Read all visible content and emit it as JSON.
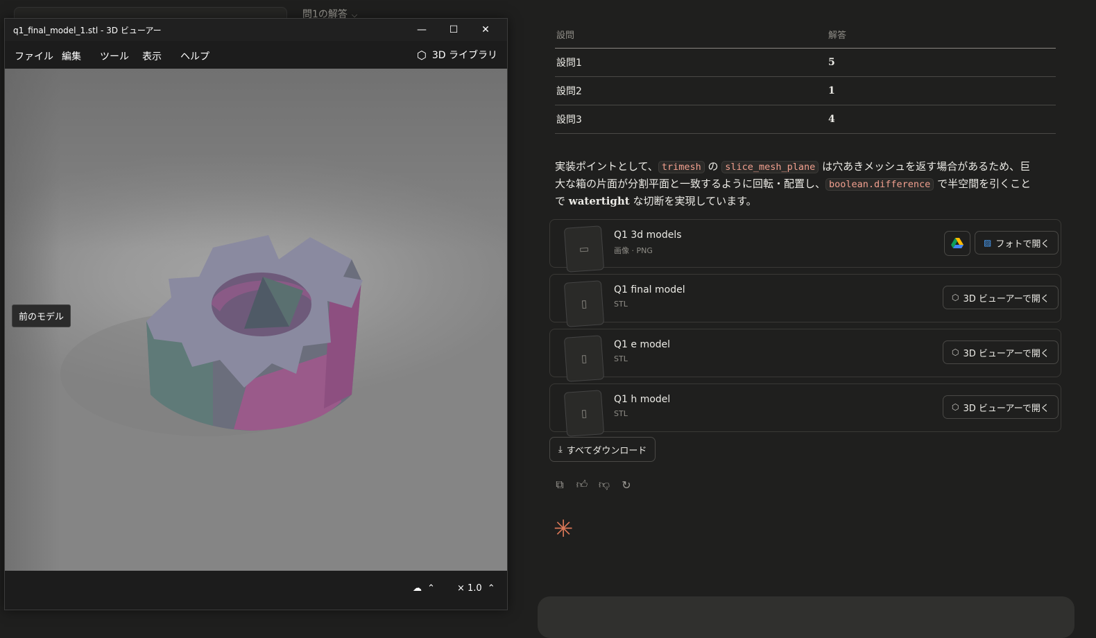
{
  "background": {
    "heading": "問1の解答",
    "table": {
      "headers": [
        "設問",
        "解答"
      ],
      "rows": [
        {
          "q": "設問1",
          "a": "5"
        },
        {
          "q": "設問2",
          "a": "1"
        },
        {
          "q": "設問3",
          "a": "4"
        }
      ]
    },
    "paragraph": {
      "p1": "実装ポイントとして、",
      "code1": "trimesh",
      "p2": " の ",
      "code2": "slice_mesh_plane",
      "p3": " は穴あきメッシュを返す場合があるため、巨大な箱の片面が分割平面と一致するように回転・配置し、",
      "code3": "boolean.difference",
      "p4": " で半空間を引くことで ",
      "serif": "watertight",
      "p5": " な切断を実現しています。"
    },
    "files": [
      {
        "name": "Q1 3d models",
        "sub": "画像 · PNG",
        "button": "フォトで開く"
      },
      {
        "name": "Q1 final model",
        "sub": "STL",
        "button": "3D ビューアーで開く"
      },
      {
        "name": "Q1 e model",
        "sub": "STL",
        "button": "3D ビューアーで開く"
      },
      {
        "name": "Q1 h model",
        "sub": "STL",
        "button": "3D ビューアーで開く"
      }
    ],
    "download_all": "すべてダウンロード"
  },
  "viewer": {
    "title": "q1_final_model_1.stl - 3D ビューアー",
    "menu": [
      "ファイル",
      "編集",
      "ツール",
      "表示",
      "ヘルプ"
    ],
    "library": "3D ライブラリ",
    "tooltip": "前のモデル",
    "zoom": "× 1.0"
  },
  "colors": {
    "accent": "#d97757",
    "code": "#f2a08f",
    "gear_top": "#8a8aa0",
    "gear_side_pink": "#9a5a8a",
    "gear_side_teal": "#5f7a78"
  }
}
